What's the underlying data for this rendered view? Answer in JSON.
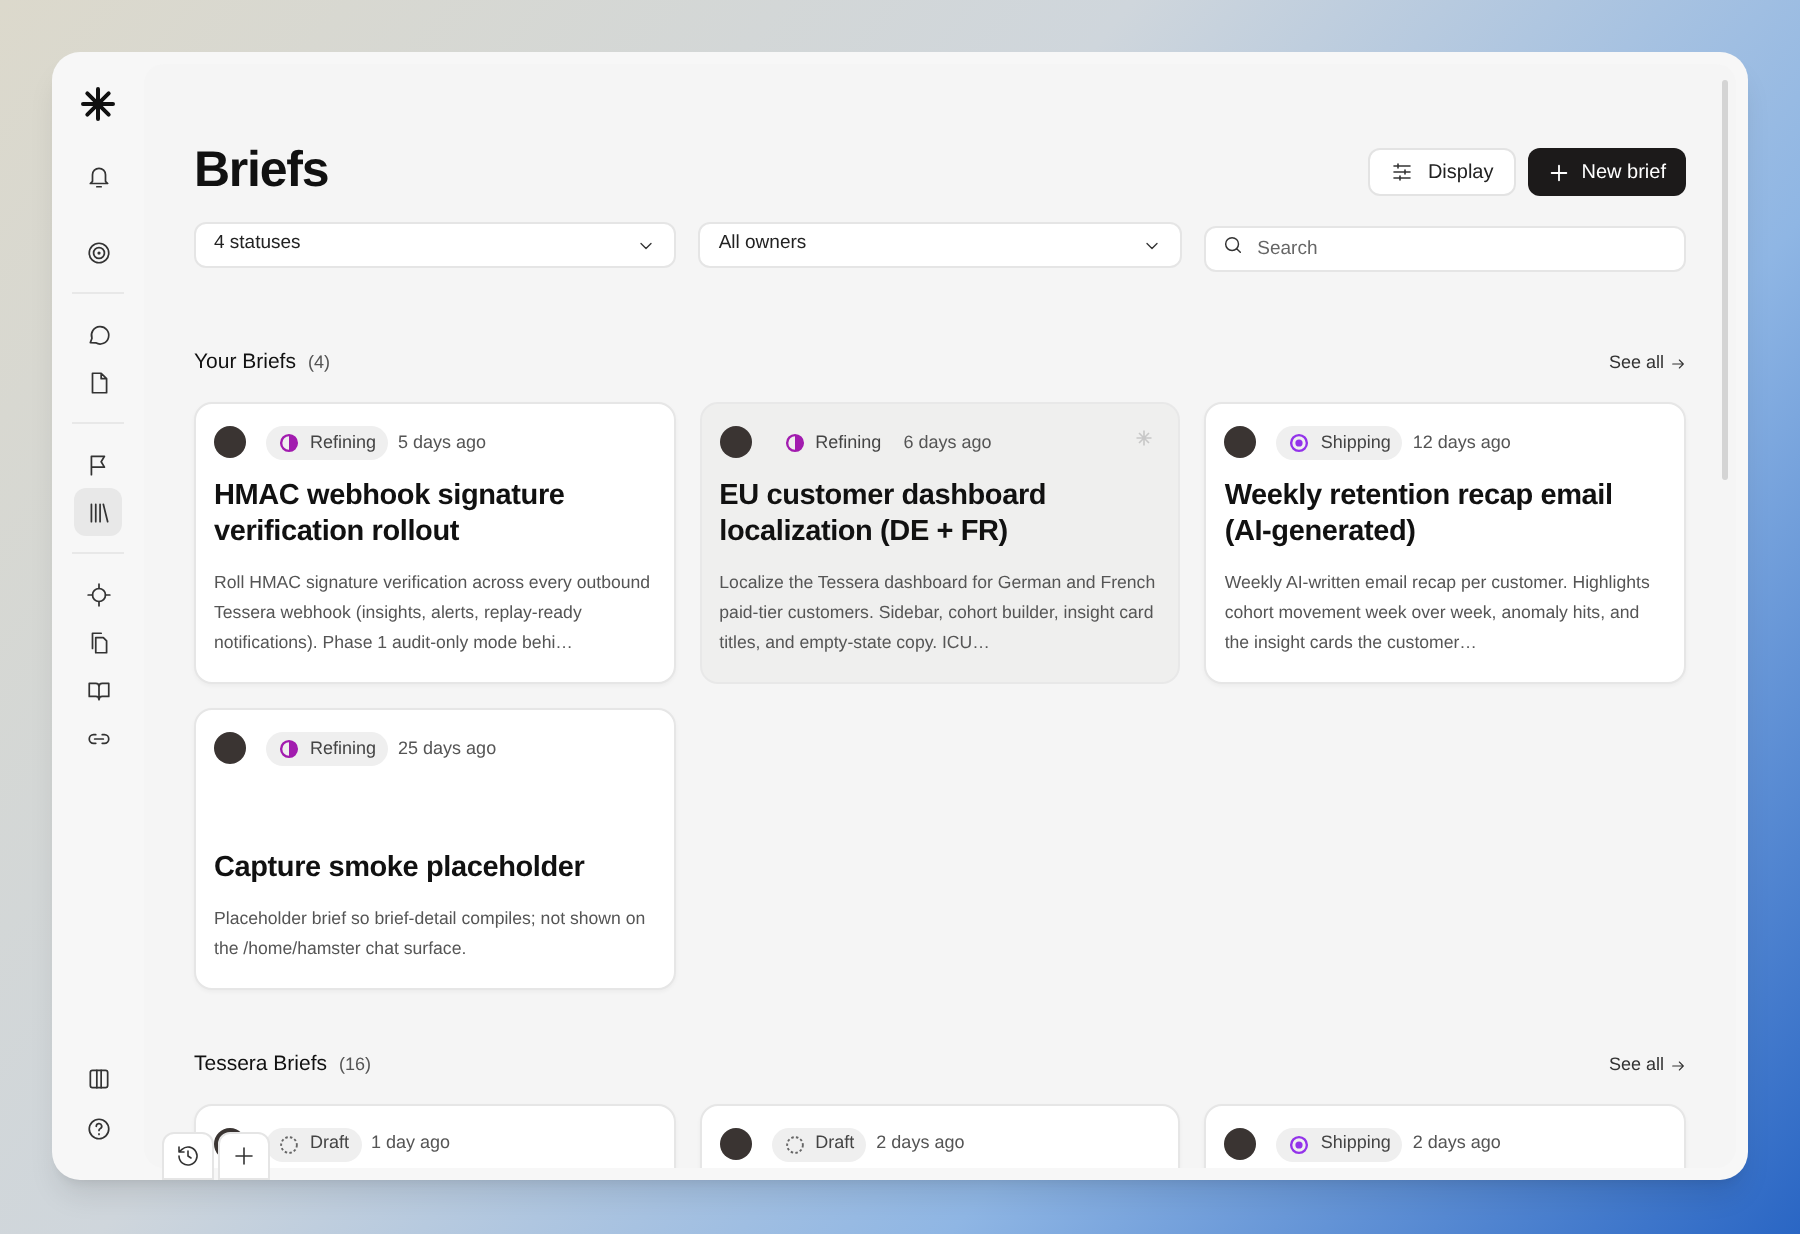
{
  "sidebar": {
    "items": [
      {
        "selected": false
      },
      {
        "selected": false
      },
      {
        "selected": false
      },
      {
        "selected": false
      },
      {
        "selected": false
      },
      {
        "selected": true
      },
      {
        "selected": false
      },
      {
        "selected": false
      },
      {
        "selected": false
      },
      {
        "selected": false
      }
    ]
  },
  "header": {
    "title": "Briefs",
    "display_button": "Display",
    "new_button": "New brief"
  },
  "filters": {
    "status": "4 statuses",
    "owner": "All owners",
    "search": {
      "placeholder": "Search"
    }
  },
  "sections": [
    {
      "title": "Your Briefs",
      "count": "(4)",
      "see_all": "See all",
      "cards": [
        {
          "kind": "refining",
          "status_label": "Refining",
          "time": "5 days ago",
          "highlighted": false,
          "title": "HMAC webhook signature verification rollout",
          "description": "Roll HMAC signature verification across every outbound Tessera webhook (insights, alerts, replay-ready notifications). Phase 1 audit-only mode behi…"
        },
        {
          "kind": "refining",
          "status_label": "Refining",
          "time": "6 days ago",
          "highlighted": true,
          "title": "EU customer dashboard localization (DE + FR)",
          "description": "Localize the Tessera dashboard for German and French paid-tier customers. Sidebar, cohort builder, insight card titles, and empty-state copy. ICU…"
        },
        {
          "kind": "shipping",
          "status_label": "Shipping",
          "time": "12 days ago",
          "highlighted": false,
          "title": "Weekly retention recap email (AI-generated)",
          "description": "Weekly AI-written email recap per customer. Highlights cohort movement week over week, anomaly hits, and the insight cards the customer…"
        },
        {
          "kind": "refining",
          "status_label": "Refining",
          "time": "25 days ago",
          "highlighted": false,
          "title": "Capture smoke placeholder",
          "description": "Placeholder brief so brief-detail compiles; not shown on the /home/hamster chat surface."
        }
      ]
    },
    {
      "title": "Tessera Briefs",
      "count": "(16)",
      "see_all": "See all",
      "cards": [
        {
          "kind": "draft",
          "status_label": "Draft",
          "time": "1 day ago",
          "highlighted": false
        },
        {
          "kind": "draft",
          "status_label": "Draft",
          "time": "2 days ago",
          "highlighted": false
        },
        {
          "kind": "shipping",
          "status_label": "Shipping",
          "time": "2 days ago",
          "highlighted": false
        }
      ]
    }
  ]
}
